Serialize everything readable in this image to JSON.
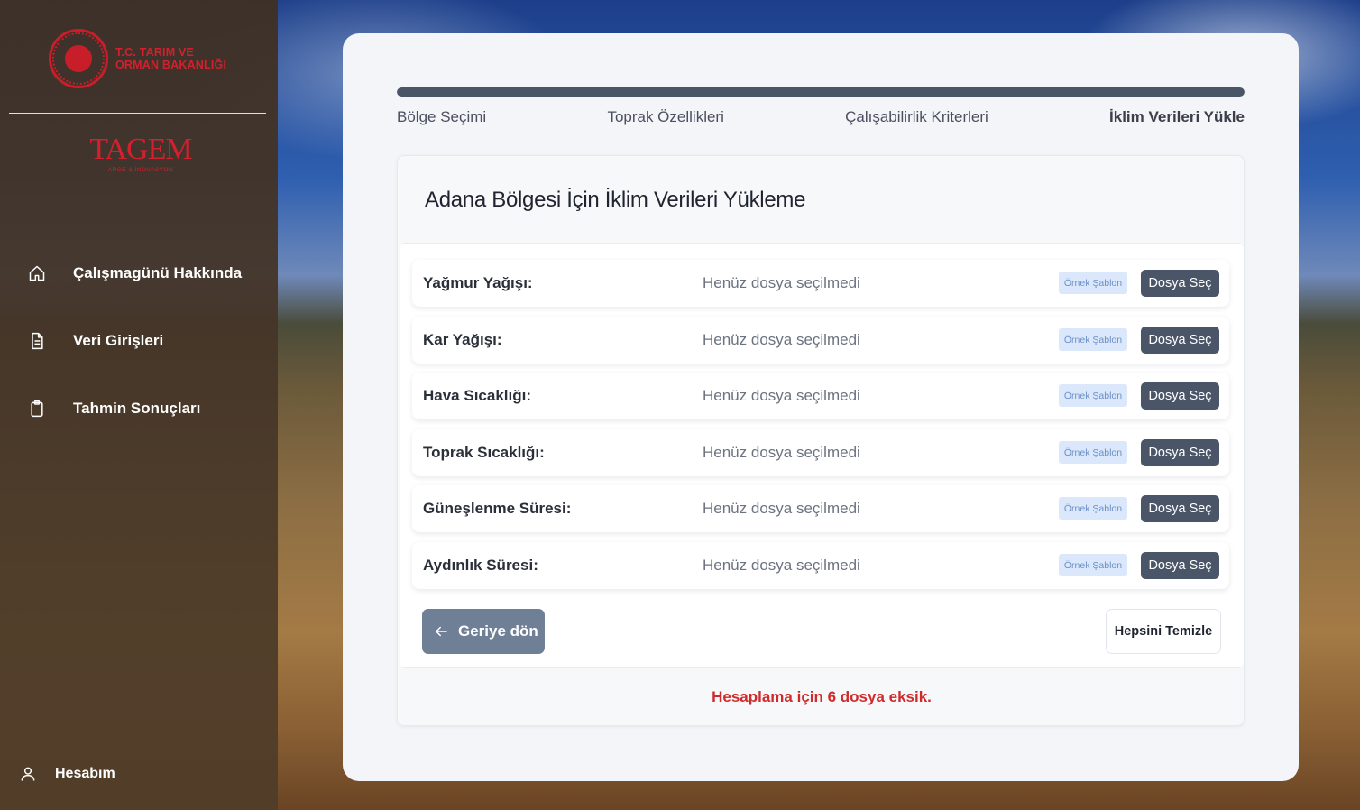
{
  "brand": {
    "ministry_line1": "T.C. TARIM VE",
    "ministry_line2": "ORMAN BAKANLIĞI",
    "tagem": "TAGEM",
    "tagem_sub": "ARGE & İNOVASYON"
  },
  "sidebar": {
    "items": [
      {
        "label": "Çalışmagünü Hakkında",
        "icon": "home-icon"
      },
      {
        "label": "Veri Girişleri",
        "icon": "document-icon"
      },
      {
        "label": "Tahmin Sonuçları",
        "icon": "clipboard-icon"
      }
    ],
    "account": {
      "label": "Hesabım",
      "icon": "user-icon"
    }
  },
  "stepper": {
    "progress": 1.0,
    "steps": [
      "Bölge Seçimi",
      "Toprak Özellikleri",
      "Çalışabilirlik Kriterleri",
      "İklim Verileri Yükle"
    ],
    "active_index": 3
  },
  "panel": {
    "title": "Adana Bölgesi İçin İklim Verileri Yükleme",
    "rows": [
      {
        "label": "Yağmur Yağışı:",
        "status": "Henüz dosya seçilmedi",
        "template": "Örnek Şablon",
        "button": "Dosya Seç"
      },
      {
        "label": "Kar Yağışı:",
        "status": "Henüz dosya seçilmedi",
        "template": "Örnek Şablon",
        "button": "Dosya Seç"
      },
      {
        "label": "Hava Sıcaklığı:",
        "status": "Henüz dosya seçilmedi",
        "template": "Örnek Şablon",
        "button": "Dosya Seç"
      },
      {
        "label": "Toprak Sıcaklığı:",
        "status": "Henüz dosya seçilmedi",
        "template": "Örnek Şablon",
        "button": "Dosya Seç"
      },
      {
        "label": "Güneşlenme Süresi:",
        "status": "Henüz dosya seçilmedi",
        "template": "Örnek Şablon",
        "button": "Dosya Seç"
      },
      {
        "label": "Aydınlık Süresi:",
        "status": "Henüz dosya seçilmedi",
        "template": "Örnek Şablon",
        "button": "Dosya Seç"
      }
    ],
    "back_label": "Geriye dön",
    "clear_label": "Hepsini Temizle",
    "missing_text": "Hesaplama için 6 dosya eksik."
  },
  "colors": {
    "accent": "#4a5568",
    "brand_red": "#d3202c",
    "error": "#d02a2a"
  }
}
